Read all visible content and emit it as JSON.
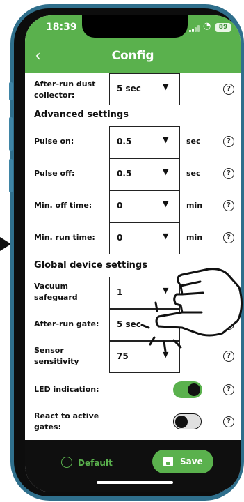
{
  "status_bar": {
    "time": "18:39",
    "battery": "89"
  },
  "header": {
    "title": "Config",
    "back_icon": "chevron-left-icon"
  },
  "rows": [
    {
      "label": "After-run dust collector:",
      "value": "5 sec",
      "unit": ""
    },
    {
      "label": "Pulse on:",
      "value": "0.5",
      "unit": "sec"
    },
    {
      "label": "Pulse off:",
      "value": "0.5",
      "unit": "sec"
    },
    {
      "label": "Min. off time:",
      "value": "0",
      "unit": "min"
    },
    {
      "label": "Min. run time:",
      "value": "0",
      "unit": "min"
    },
    {
      "label": "Vacuum safeguard",
      "value": "1",
      "unit": ""
    },
    {
      "label": "After-run gate:",
      "value": "5 sec",
      "unit": ""
    },
    {
      "label": "Sensor sensitivity",
      "value": "75",
      "unit": ""
    }
  ],
  "sections": {
    "advanced": "Advanced settings",
    "global": "Global device settings"
  },
  "toggles": [
    {
      "label": "LED indication:",
      "on": true
    },
    {
      "label": "React to active gates:",
      "on": false
    }
  ],
  "help_glyph": "?",
  "dropdown_glyph": "▼",
  "footer": {
    "default_label": "Default",
    "save_label": "Save"
  },
  "colors": {
    "accent": "#5ab14d",
    "frame": "#2f6f8c",
    "footer": "#0f0f0f"
  }
}
